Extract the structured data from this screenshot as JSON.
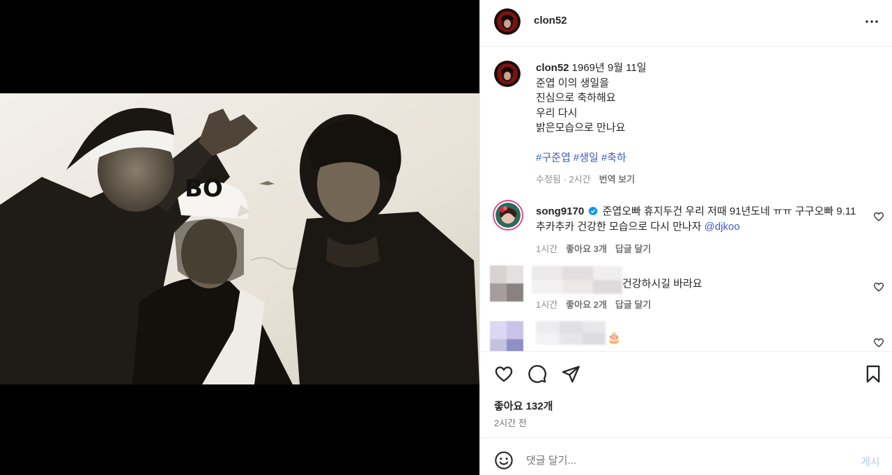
{
  "post": {
    "username": "clon52",
    "caption_lines": [
      "1969년 9월 11일",
      "준엽 이의 생일을",
      "진심으로 축하해요",
      "우리 다시",
      "밝은모습으로 만나요"
    ],
    "hashtags": [
      "#구준엽",
      "#생일",
      "#축하"
    ],
    "edited": "수정됨",
    "time": "2시간",
    "translate": "번역 보기"
  },
  "comments": [
    {
      "username": "song9170",
      "text": "준엽오빠 휴지두건 우리 저때 91년도네 ㅠㅠ 구구오빠 9.11 추카추카 건강한 모습으로 다시 만나자",
      "mention": "@djkoo",
      "time": "1시간",
      "likes": "좋아요 3개",
      "reply": "답글 달기",
      "verified": true
    },
    {
      "username": "",
      "text": "건강하시길 바라요",
      "time": "1시간",
      "likes": "좋아요 2개",
      "reply": "답글 달기"
    },
    {
      "username": "",
      "text": "🎂"
    }
  ],
  "footer": {
    "likes": "좋아요 132개",
    "time": "2시간 전",
    "comment_placeholder": "댓글 달기...",
    "post_label": "게시"
  },
  "colors": {
    "link": "#3a5bbf",
    "post_disabled": "#b2c9e9",
    "muted": "#737373"
  },
  "icons": [
    "more-icon",
    "heart-icon",
    "comment-icon",
    "share-icon",
    "bookmark-icon",
    "emoji-icon",
    "verified-icon"
  ]
}
